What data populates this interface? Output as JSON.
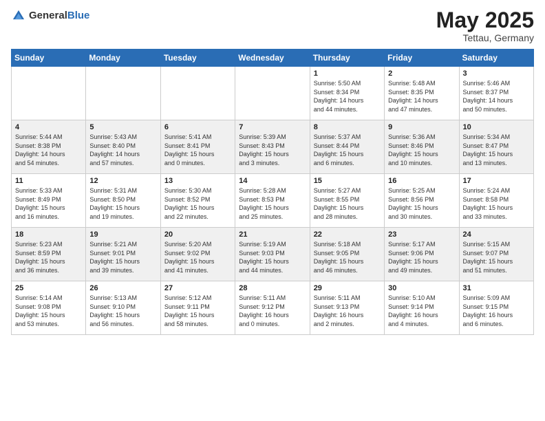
{
  "header": {
    "logo_general": "General",
    "logo_blue": "Blue",
    "month_year": "May 2025",
    "location": "Tettau, Germany"
  },
  "days_of_week": [
    "Sunday",
    "Monday",
    "Tuesday",
    "Wednesday",
    "Thursday",
    "Friday",
    "Saturday"
  ],
  "weeks": [
    [
      {
        "day": "",
        "info": ""
      },
      {
        "day": "",
        "info": ""
      },
      {
        "day": "",
        "info": ""
      },
      {
        "day": "",
        "info": ""
      },
      {
        "day": "1",
        "info": "Sunrise: 5:50 AM\nSunset: 8:34 PM\nDaylight: 14 hours\nand 44 minutes."
      },
      {
        "day": "2",
        "info": "Sunrise: 5:48 AM\nSunset: 8:35 PM\nDaylight: 14 hours\nand 47 minutes."
      },
      {
        "day": "3",
        "info": "Sunrise: 5:46 AM\nSunset: 8:37 PM\nDaylight: 14 hours\nand 50 minutes."
      }
    ],
    [
      {
        "day": "4",
        "info": "Sunrise: 5:44 AM\nSunset: 8:38 PM\nDaylight: 14 hours\nand 54 minutes."
      },
      {
        "day": "5",
        "info": "Sunrise: 5:43 AM\nSunset: 8:40 PM\nDaylight: 14 hours\nand 57 minutes."
      },
      {
        "day": "6",
        "info": "Sunrise: 5:41 AM\nSunset: 8:41 PM\nDaylight: 15 hours\nand 0 minutes."
      },
      {
        "day": "7",
        "info": "Sunrise: 5:39 AM\nSunset: 8:43 PM\nDaylight: 15 hours\nand 3 minutes."
      },
      {
        "day": "8",
        "info": "Sunrise: 5:37 AM\nSunset: 8:44 PM\nDaylight: 15 hours\nand 6 minutes."
      },
      {
        "day": "9",
        "info": "Sunrise: 5:36 AM\nSunset: 8:46 PM\nDaylight: 15 hours\nand 10 minutes."
      },
      {
        "day": "10",
        "info": "Sunrise: 5:34 AM\nSunset: 8:47 PM\nDaylight: 15 hours\nand 13 minutes."
      }
    ],
    [
      {
        "day": "11",
        "info": "Sunrise: 5:33 AM\nSunset: 8:49 PM\nDaylight: 15 hours\nand 16 minutes."
      },
      {
        "day": "12",
        "info": "Sunrise: 5:31 AM\nSunset: 8:50 PM\nDaylight: 15 hours\nand 19 minutes."
      },
      {
        "day": "13",
        "info": "Sunrise: 5:30 AM\nSunset: 8:52 PM\nDaylight: 15 hours\nand 22 minutes."
      },
      {
        "day": "14",
        "info": "Sunrise: 5:28 AM\nSunset: 8:53 PM\nDaylight: 15 hours\nand 25 minutes."
      },
      {
        "day": "15",
        "info": "Sunrise: 5:27 AM\nSunset: 8:55 PM\nDaylight: 15 hours\nand 28 minutes."
      },
      {
        "day": "16",
        "info": "Sunrise: 5:25 AM\nSunset: 8:56 PM\nDaylight: 15 hours\nand 30 minutes."
      },
      {
        "day": "17",
        "info": "Sunrise: 5:24 AM\nSunset: 8:58 PM\nDaylight: 15 hours\nand 33 minutes."
      }
    ],
    [
      {
        "day": "18",
        "info": "Sunrise: 5:23 AM\nSunset: 8:59 PM\nDaylight: 15 hours\nand 36 minutes."
      },
      {
        "day": "19",
        "info": "Sunrise: 5:21 AM\nSunset: 9:01 PM\nDaylight: 15 hours\nand 39 minutes."
      },
      {
        "day": "20",
        "info": "Sunrise: 5:20 AM\nSunset: 9:02 PM\nDaylight: 15 hours\nand 41 minutes."
      },
      {
        "day": "21",
        "info": "Sunrise: 5:19 AM\nSunset: 9:03 PM\nDaylight: 15 hours\nand 44 minutes."
      },
      {
        "day": "22",
        "info": "Sunrise: 5:18 AM\nSunset: 9:05 PM\nDaylight: 15 hours\nand 46 minutes."
      },
      {
        "day": "23",
        "info": "Sunrise: 5:17 AM\nSunset: 9:06 PM\nDaylight: 15 hours\nand 49 minutes."
      },
      {
        "day": "24",
        "info": "Sunrise: 5:15 AM\nSunset: 9:07 PM\nDaylight: 15 hours\nand 51 minutes."
      }
    ],
    [
      {
        "day": "25",
        "info": "Sunrise: 5:14 AM\nSunset: 9:08 PM\nDaylight: 15 hours\nand 53 minutes."
      },
      {
        "day": "26",
        "info": "Sunrise: 5:13 AM\nSunset: 9:10 PM\nDaylight: 15 hours\nand 56 minutes."
      },
      {
        "day": "27",
        "info": "Sunrise: 5:12 AM\nSunset: 9:11 PM\nDaylight: 15 hours\nand 58 minutes."
      },
      {
        "day": "28",
        "info": "Sunrise: 5:11 AM\nSunset: 9:12 PM\nDaylight: 16 hours\nand 0 minutes."
      },
      {
        "day": "29",
        "info": "Sunrise: 5:11 AM\nSunset: 9:13 PM\nDaylight: 16 hours\nand 2 minutes."
      },
      {
        "day": "30",
        "info": "Sunrise: 5:10 AM\nSunset: 9:14 PM\nDaylight: 16 hours\nand 4 minutes."
      },
      {
        "day": "31",
        "info": "Sunrise: 5:09 AM\nSunset: 9:15 PM\nDaylight: 16 hours\nand 6 minutes."
      }
    ]
  ]
}
